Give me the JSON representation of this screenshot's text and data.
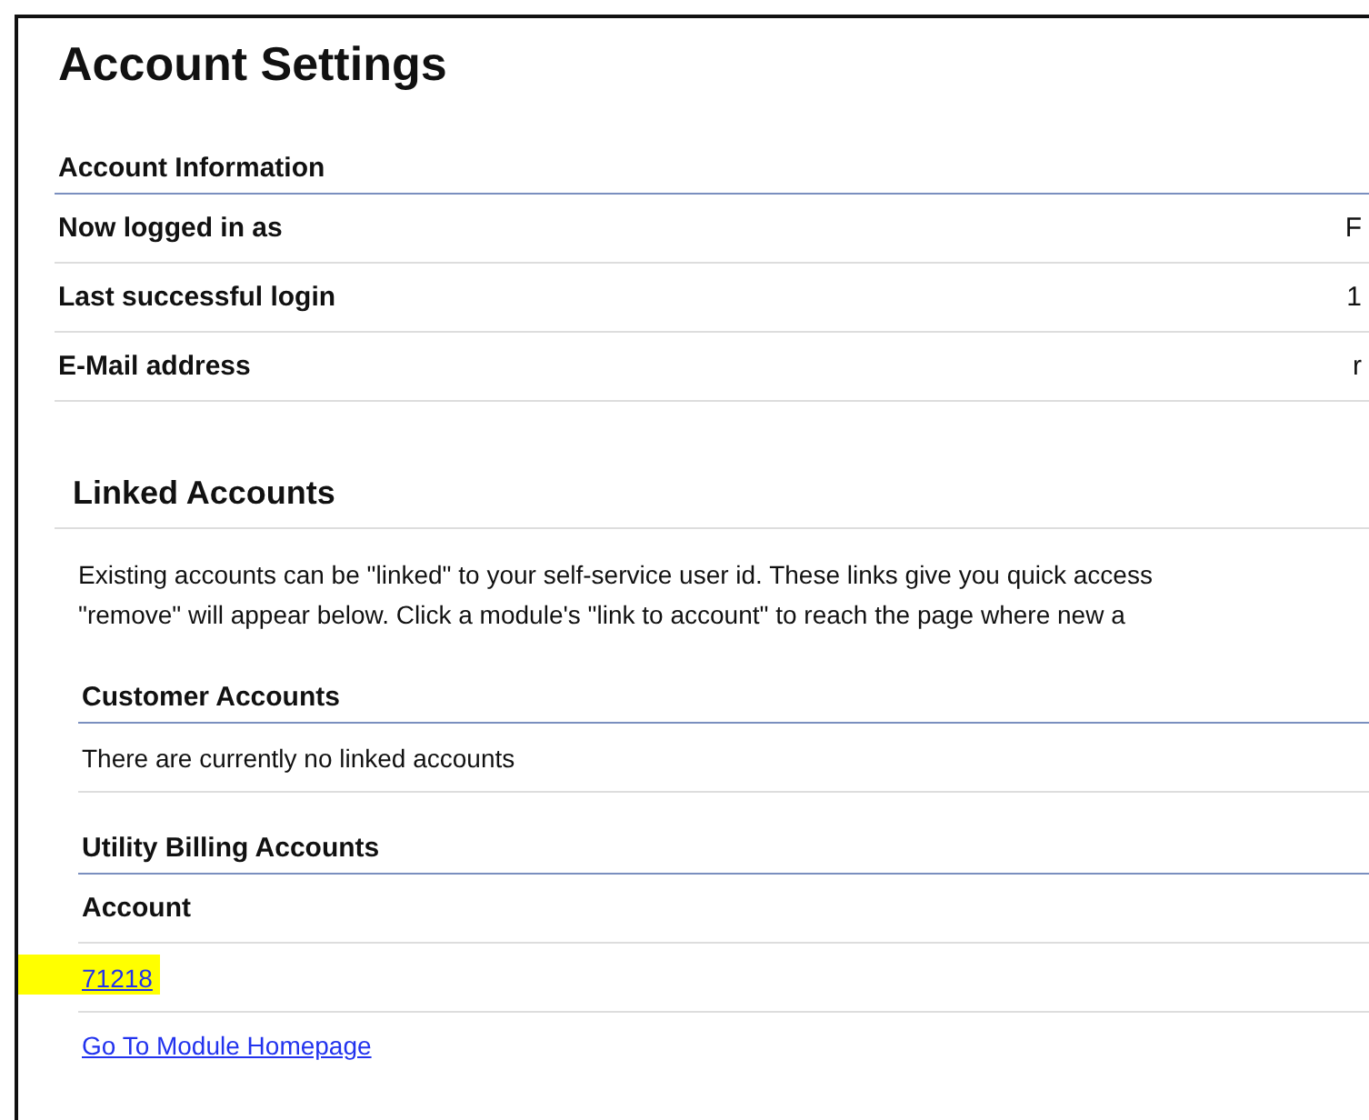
{
  "title": "Account Settings",
  "account_information": {
    "heading": "Account Information",
    "rows": [
      {
        "label": "Now logged in as",
        "value": "F"
      },
      {
        "label": "Last successful login",
        "value": "1"
      },
      {
        "label": "E-Mail address",
        "value": "r"
      }
    ]
  },
  "linked_accounts": {
    "heading": "Linked Accounts",
    "description": [
      "Existing accounts can be \"linked\" to your self-service user id. These links give you quick access",
      "\"remove\" will appear below. Click a module's \"link to account\" to reach the page where new a"
    ],
    "sections": [
      {
        "kind": "empty",
        "heading": "Customer Accounts",
        "message": "There are currently no linked accounts"
      },
      {
        "kind": "table",
        "heading": "Utility Billing Accounts",
        "column": "Account",
        "rows": [
          {
            "account": "71218",
            "highlighted": true
          }
        ],
        "link": "Go To Module Homepage"
      }
    ]
  }
}
